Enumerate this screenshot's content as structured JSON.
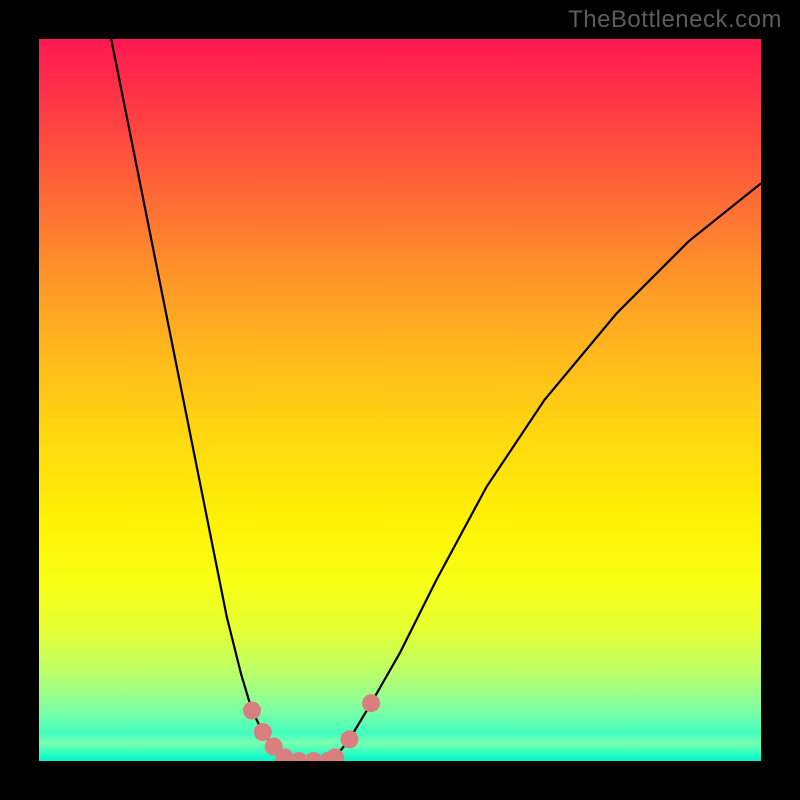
{
  "watermark": "TheBottleneck.com",
  "colors": {
    "page_bg": "#000000",
    "watermark": "#5c5c5c",
    "curve": "#000000",
    "marker": "#d97f7f",
    "gradient_top": "#ff1851",
    "gradient_bottom": "#00ffd0"
  },
  "chart_data": {
    "type": "line",
    "title": "",
    "xlabel": "",
    "ylabel": "",
    "xlim": [
      0,
      100
    ],
    "ylim": [
      0,
      100
    ],
    "grid": false,
    "legend": false,
    "series": [
      {
        "name": "left-curve",
        "x": [
          10,
          12,
          15,
          18,
          21,
          24,
          26,
          28,
          29.5,
          31,
          32.5,
          34
        ],
        "y": [
          100,
          90,
          75,
          60,
          45,
          30,
          20,
          12,
          7,
          4,
          2,
          0.5
        ]
      },
      {
        "name": "right-curve",
        "x": [
          41,
          43,
          46,
          50,
          55,
          62,
          70,
          80,
          90,
          100
        ],
        "y": [
          0.5,
          3,
          8,
          15,
          25,
          38,
          50,
          62,
          72,
          80
        ]
      },
      {
        "name": "valley-floor",
        "x": [
          34,
          36,
          38,
          40,
          41
        ],
        "y": [
          0.5,
          0,
          0,
          0,
          0.5
        ]
      }
    ],
    "markers": [
      {
        "series": "left-curve",
        "x": 29.5,
        "y": 7
      },
      {
        "series": "left-curve",
        "x": 31,
        "y": 4
      },
      {
        "series": "left-curve",
        "x": 32.5,
        "y": 2
      },
      {
        "series": "valley-floor",
        "x": 34,
        "y": 0.5
      },
      {
        "series": "valley-floor",
        "x": 36,
        "y": 0
      },
      {
        "series": "valley-floor",
        "x": 38,
        "y": 0
      },
      {
        "series": "valley-floor",
        "x": 40,
        "y": 0
      },
      {
        "series": "right-curve",
        "x": 41,
        "y": 0.5
      },
      {
        "series": "right-curve",
        "x": 43,
        "y": 3
      },
      {
        "series": "right-curve",
        "x": 46,
        "y": 8
      }
    ]
  }
}
